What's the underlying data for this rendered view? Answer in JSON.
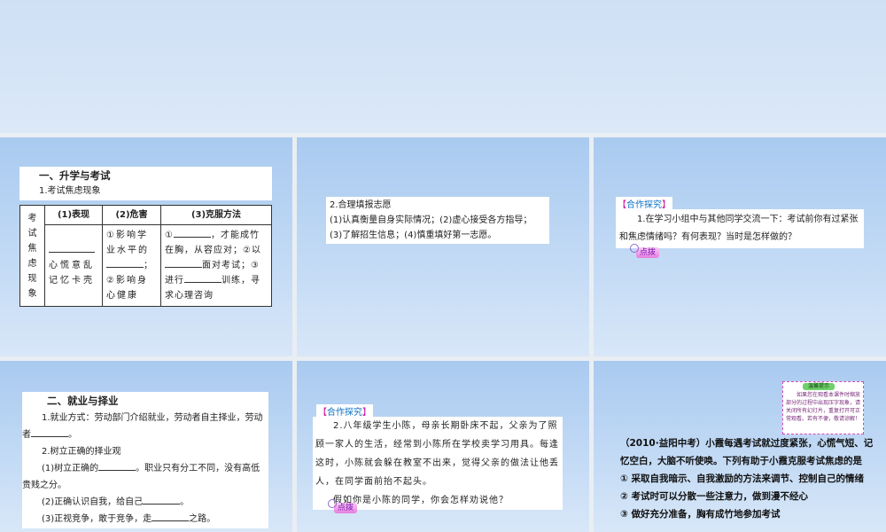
{
  "slide1": {
    "title": "一、升学与考试",
    "subtitle": "1.考试焦虑现象",
    "row_label": "考试焦虑现象",
    "headers": [
      "(1)表现",
      "(2)危害",
      "(3)克服方法"
    ],
    "col1": "心慌意乱记忆卡壳",
    "col2a": "①影响学业水平的",
    "col2b": "；②影响身心健康",
    "col3a": "①",
    "col3b": "，才能成竹在胸，从容应对；②以",
    "col3c": "面对考试；③进行",
    "col3d": "训练，寻求心理咨询"
  },
  "slide2": {
    "title": "2.合理填报志愿",
    "line1": "(1)认真衡量自身实际情况；(2)虚心接受各方指导；",
    "line2": "(3)了解招生信息；(4)慎重填好第一志愿。"
  },
  "slide3": {
    "tag": "合作探究",
    "question": "1.在学习小组中与其他同学交流一下：考试前你有过紧张和焦虑情绪吗？有何表现？当时是怎样做的？",
    "hint": "点拨"
  },
  "slide4": {
    "title": "二、就业与择业",
    "p1a": "1.就业方式：劳动部门介绍就业，劳动者自主择业，劳动者",
    "p1b": "。",
    "p2": "2.树立正确的择业观",
    "p3a": "(1)树立正确的",
    "p3b": "。职业只有分工不同，没有高低贵贱之分。",
    "p4a": "(2)正确认识自我，给自己",
    "p4b": "。",
    "p5a": "(3)正视竞争，敢于竞争，走",
    "p5b": "之路。"
  },
  "slide5": {
    "tag": "合作探究",
    "p1": "2.八年级学生小陈，母亲长期卧床不起，父亲为了照顾一家人的生活，经常到小陈所在学校卖学习用具。每逢这时，小陈就会躲在教室不出来，觉得父亲的做法让他丢人，在同学面前抬不起头。",
    "p2": "假如你是小陈的同学，你会怎样劝说他？",
    "hint": "点拨"
  },
  "slide6": {
    "notice_title": "温馨提示",
    "notice_text": "如果您在观看本课件时缩放部分的过程中出现压字现象，请关闭所有幻灯片，重复打开可正常观看。若有不便，敬请谅解！",
    "question": "（2010·益阳中考）小霞每遇考试就过度紧张，心慌气短、记忆空白，大脑不听使唤。下列有助于小霞克服考试焦虑的是",
    "options": [
      "① 采取自我暗示、自我激励的方法来调节、控制自己的情绪",
      "② 考试时可以分散一些注意力，做到漫不经心",
      "③ 做好充分准备，胸有成竹地参加考试"
    ]
  }
}
